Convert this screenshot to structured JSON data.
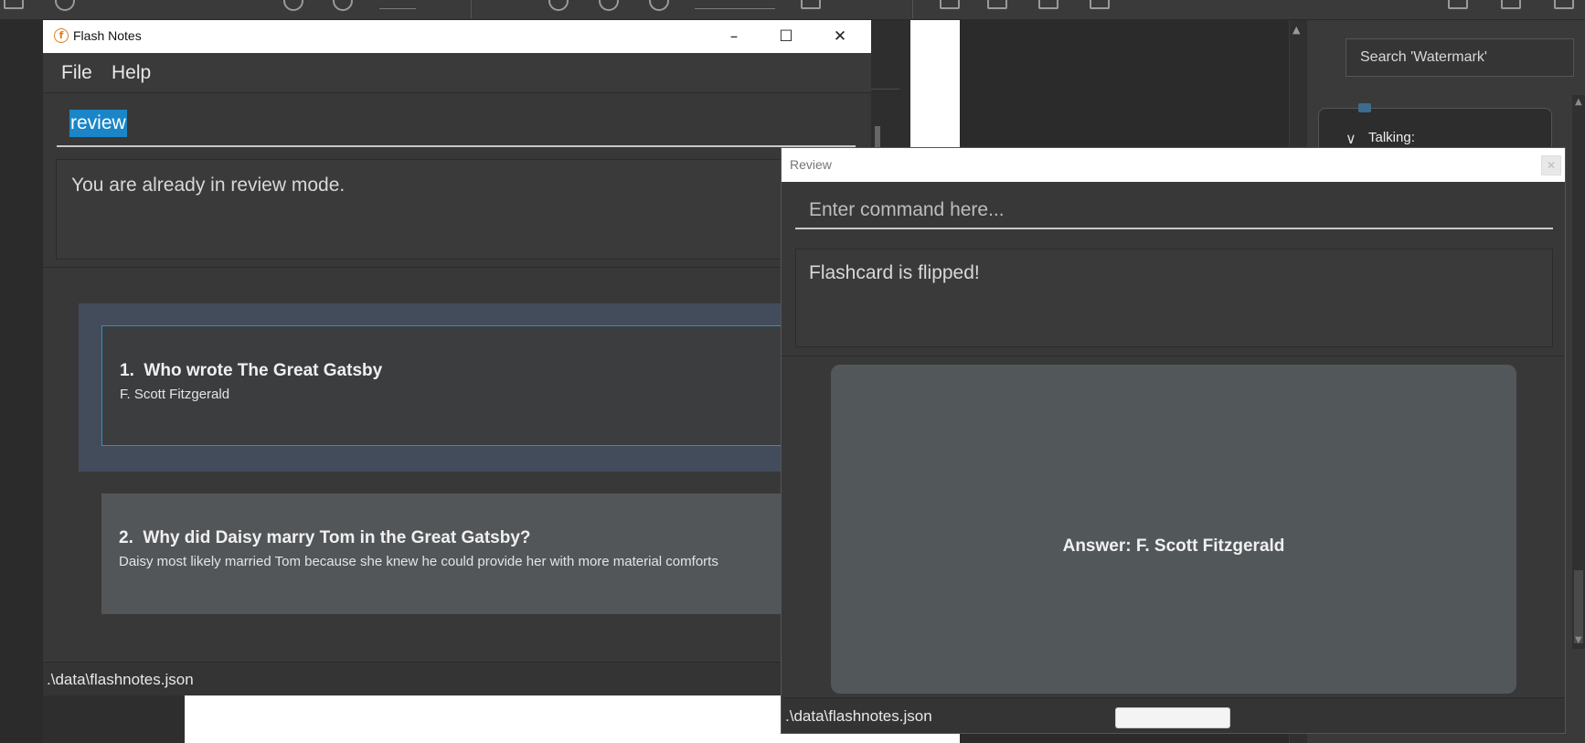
{
  "background_app": {
    "search_placeholder": "Search 'Watermark'",
    "talking_label": "Talking:"
  },
  "main_window": {
    "title": "Flash Notes",
    "menu": {
      "file": "File",
      "help": "Help"
    },
    "command_text": "review",
    "result_text": "You are already in review mode.",
    "flashcards": [
      {
        "index": "1.",
        "question": "Who wrote The Great Gatsby",
        "answer": "F. Scott Fitzgerald",
        "selected": true
      },
      {
        "index": "2.",
        "question": "Why did Daisy marry Tom in the Great Gatsby?",
        "answer": "Daisy most likely married Tom because she knew he could provide her with more material comforts",
        "selected": false
      }
    ],
    "status_path": ".\\data\\flashnotes.json"
  },
  "review_window": {
    "title": "Review",
    "command_placeholder": "Enter command here...",
    "result_text": "Flashcard is flipped!",
    "card_text": "Answer: F. Scott Fitzgerald",
    "status_path": ".\\data\\flashnotes.json"
  },
  "colors": {
    "accent_selection": "#1a86c8",
    "selected_card_border": "#2f8fc9",
    "selected_card_background": "#434c5b",
    "app_icon": "#e07b20"
  },
  "icons": [
    "app-logo-icon",
    "minimize-icon",
    "maximize-icon",
    "close-icon",
    "chevron-down-icon"
  ]
}
